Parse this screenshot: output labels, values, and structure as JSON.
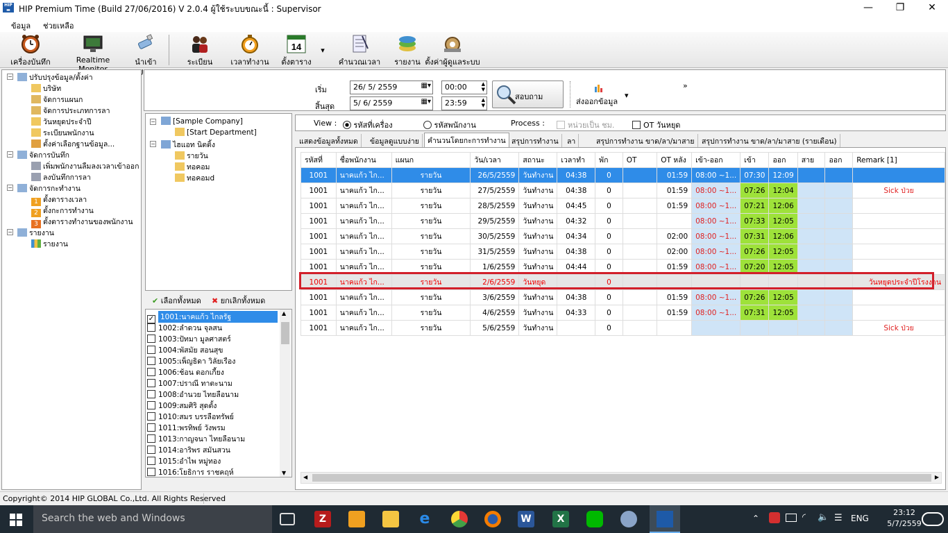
{
  "window": {
    "title": "HIP Premium Time (Build 27/06/2016) V 2.0.4   ผู้ใช้ระบบขณะนี้ : Supervisor",
    "controls": [
      "—",
      "❐",
      "✕"
    ]
  },
  "menu": [
    "ข้อมูล",
    "ช่วยเหลือ"
  ],
  "toolbar": [
    {
      "label": "เครื่องบันทึกเวลา",
      "icon": "alarm-clock-icon"
    },
    {
      "label": "Realtime Monitor",
      "icon": "monitor-icon"
    },
    {
      "label": "นำเข้า USB",
      "icon": "usb-icon"
    },
    {
      "label": "ระเบียนพนักงาน",
      "icon": "employees-icon"
    },
    {
      "label": "เวลาทำงาน",
      "icon": "stopwatch-icon"
    },
    {
      "label": "ตั้งตารางเวลา",
      "icon": "calendar-icon",
      "badge": "14"
    },
    {
      "label": "คำนวณเวลาทำงาน",
      "icon": "calculate-icon"
    },
    {
      "label": "รายงาน",
      "icon": "report-icon"
    },
    {
      "label": "ตั้งค่าผู้ดูแลระบบ",
      "icon": "admin-settings-icon"
    }
  ],
  "nav_tree": [
    {
      "label": "ปรับปรุงข้อมูล/ตั้งค่า",
      "level": 0
    },
    {
      "label": "บริษัท",
      "level": 1
    },
    {
      "label": "จัดการแผนก",
      "level": 1
    },
    {
      "label": "จัดการประเภทการลา",
      "level": 1
    },
    {
      "label": "วันหยุดประจำปี",
      "level": 1
    },
    {
      "label": "ระเบียนพนักงาน",
      "level": 1
    },
    {
      "label": "ตั้งค่าเลือกฐานข้อมูล...",
      "level": 1
    },
    {
      "label": "จัดการบันทึก",
      "level": 0
    },
    {
      "label": "เพิ่มพนักงานลืมลงเวลาเข้าออก",
      "level": 1
    },
    {
      "label": "ลงบันทึกการลา",
      "level": 1
    },
    {
      "label": "จัดการกะทำงาน",
      "level": 0
    },
    {
      "label": "ตั้งตารางเวลา",
      "level": 1,
      "num": "1"
    },
    {
      "label": "ตั้งกะการทำงาน",
      "level": 1,
      "num": "2"
    },
    {
      "label": "ตั้งตารางทำงานของพนักงาน",
      "level": 1,
      "num": "3"
    },
    {
      "label": "รายงาน",
      "level": 0
    },
    {
      "label": "รายงาน",
      "level": 1
    }
  ],
  "query": {
    "start_label": "เริ่ม",
    "end_label": "สิ้นสุด",
    "start_date": "26/  5/  2559",
    "end_date": "5/  6/  2559",
    "start_time": "00:00",
    "end_time": "23:59",
    "search_label": "สอบถาม",
    "export_label": "ส่งออกข้อมูล",
    "more": "»"
  },
  "dept_tree": [
    {
      "label": "[Sample Company]",
      "level": 0
    },
    {
      "label": "[Start Department]",
      "level": 1
    },
    {
      "label": "ไฮแอท นิตติ้ง",
      "level": 0
    },
    {
      "label": "รายวัน",
      "level": 1
    },
    {
      "label": "ทอคอม",
      "level": 1
    },
    {
      "label": "ทอคอมd",
      "level": 1
    }
  ],
  "select_bar": {
    "select_all": "เลือกทั้งหมด",
    "deselect_all": "ยกเลิกทั้งหมด"
  },
  "employees": [
    {
      "label": "1001:นาคแก้ว  ไกลรัฐ",
      "checked": true
    },
    {
      "label": "1002:ลำดวน  จุลสน",
      "checked": false
    },
    {
      "label": "1003:ปัทมา  มูลศาสตร์",
      "checked": false
    },
    {
      "label": "1004:พัสมัย  สอนสุข",
      "checked": false
    },
    {
      "label": "1005:เพ็ญธิดา  วิลัยเรือง",
      "checked": false
    },
    {
      "label": "1006:ช้อน ดอกเกี้ยง",
      "checked": false
    },
    {
      "label": "1007:ปราณี  ทาตะนาม",
      "checked": false
    },
    {
      "label": "1008:อำนวย  ไทยลือนาม",
      "checked": false
    },
    {
      "label": "1009:สมศิริ  สุดตั้ง",
      "checked": false
    },
    {
      "label": "1010:สมร  บรรลือทรัพย์",
      "checked": false
    },
    {
      "label": "1011:พรทิพย์  วังพรม",
      "checked": false
    },
    {
      "label": "1013:กาญจนา  ไทยลือนาม",
      "checked": false
    },
    {
      "label": "1014:อาริพร  สมันสวน",
      "checked": false
    },
    {
      "label": "1015:อำไพ  หมู่ทอง",
      "checked": false
    },
    {
      "label": "1016:โยธิการ ราชคฤห์",
      "checked": false
    }
  ],
  "view_bar": {
    "view_label": "View :",
    "opt1": "รหัสที่เครื่อง",
    "opt2": "รหัสพนักงาน",
    "process_label": "Process :",
    "unit_label": "หน่วยเป็น ชม.",
    "ot_holiday_label": "OT วันหยุด"
  },
  "tabs": [
    "แสดงข้อมูลทั้งหมด",
    "ข้อมูลดูแบบง่าย",
    "คำนวนโดยกะการทำงาน",
    "สรุปการทำงาน",
    "ลา",
    "สรุปการทำงาน ขาด/ลา/มาสาย",
    "สรุปการทำงาน ขาด/ลา/มาสาย (รายเดือน)"
  ],
  "active_tab": 2,
  "grid": {
    "columns": [
      "รหัสที่",
      "ชื่อพนักงาน",
      "แผนก",
      "วัน/เวลา",
      "สถานะ",
      "เวลาทำ",
      "พัก",
      "OT",
      "OT หลัง",
      "เข้า-ออก",
      "เข้า",
      "ออก",
      "สาย",
      "ออก",
      "Remark [1]"
    ],
    "rows": [
      {
        "id": "1001",
        "name": "นาคแก้ว  ไก...",
        "dept": "รายวัน",
        "date": "26/5/2559",
        "status": "วันทำงาน",
        "work": "04:38",
        "brk": "0",
        "ot": "",
        "ot_after": "01:59",
        "inout": "08:00 ~1...",
        "in": "07:30",
        "out": "12:09",
        "late": "",
        "out2": "",
        "remark": "",
        "style": "sel"
      },
      {
        "id": "1001",
        "name": "นาคแก้ว  ไก...",
        "dept": "รายวัน",
        "date": "27/5/2559",
        "status": "วันทำงาน",
        "work": "04:38",
        "brk": "0",
        "ot": "",
        "ot_after": "01:59",
        "inout": "08:00 ~1...",
        "in": "07:26",
        "out": "12:04",
        "late": "",
        "out2": "",
        "remark": "Sick ป่วย",
        "style": ""
      },
      {
        "id": "1001",
        "name": "นาคแก้ว  ไก...",
        "dept": "รายวัน",
        "date": "28/5/2559",
        "status": "วันทำงาน",
        "work": "04:45",
        "brk": "0",
        "ot": "",
        "ot_after": "01:59",
        "inout": "08:00 ~1...",
        "in": "07:21",
        "out": "12:06",
        "late": "",
        "out2": "",
        "remark": "",
        "style": ""
      },
      {
        "id": "1001",
        "name": "นาคแก้ว  ไก...",
        "dept": "รายวัน",
        "date": "29/5/2559",
        "status": "วันทำงาน",
        "work": "04:32",
        "brk": "0",
        "ot": "",
        "ot_after": "",
        "inout": "08:00 ~1...",
        "in": "07:33",
        "out": "12:05",
        "late": "",
        "out2": "",
        "remark": "",
        "style": ""
      },
      {
        "id": "1001",
        "name": "นาคแก้ว  ไก...",
        "dept": "รายวัน",
        "date": "30/5/2559",
        "status": "วันทำงาน",
        "work": "04:34",
        "brk": "0",
        "ot": "",
        "ot_after": "02:00",
        "inout": "08:00 ~1...",
        "in": "07:31",
        "out": "12:06",
        "late": "",
        "out2": "",
        "remark": "",
        "style": ""
      },
      {
        "id": "1001",
        "name": "นาคแก้ว  ไก...",
        "dept": "รายวัน",
        "date": "31/5/2559",
        "status": "วันทำงาน",
        "work": "04:38",
        "brk": "0",
        "ot": "",
        "ot_after": "02:00",
        "inout": "08:00 ~1...",
        "in": "07:26",
        "out": "12:05",
        "late": "",
        "out2": "",
        "remark": "",
        "style": ""
      },
      {
        "id": "1001",
        "name": "นาคแก้ว  ไก...",
        "dept": "รายวัน",
        "date": "1/6/2559",
        "status": "วันทำงาน",
        "work": "04:44",
        "brk": "0",
        "ot": "",
        "ot_after": "01:59",
        "inout": "08:00 ~1...",
        "in": "07:20",
        "out": "12:05",
        "late": "",
        "out2": "",
        "remark": "",
        "style": ""
      },
      {
        "id": "1001",
        "name": "นาคแก้ว  ไก...",
        "dept": "รายวัน",
        "date": "2/6/2559",
        "status": "วันหยุด",
        "work": "",
        "brk": "0",
        "ot": "",
        "ot_after": "",
        "inout": "",
        "in": "",
        "out": "",
        "late": "",
        "out2": "",
        "remark": "วันหยุดประจำปีโรงงาน",
        "style": "hol"
      },
      {
        "id": "1001",
        "name": "นาคแก้ว  ไก...",
        "dept": "รายวัน",
        "date": "3/6/2559",
        "status": "วันทำงาน",
        "work": "04:38",
        "brk": "0",
        "ot": "",
        "ot_after": "01:59",
        "inout": "08:00 ~1...",
        "in": "07:26",
        "out": "12:05",
        "late": "",
        "out2": "",
        "remark": "",
        "style": ""
      },
      {
        "id": "1001",
        "name": "นาคแก้ว  ไก...",
        "dept": "รายวัน",
        "date": "4/6/2559",
        "status": "วันทำงาน",
        "work": "04:33",
        "brk": "0",
        "ot": "",
        "ot_after": "01:59",
        "inout": "08:00 ~1...",
        "in": "07:31",
        "out": "12:05",
        "late": "",
        "out2": "",
        "remark": "",
        "style": ""
      },
      {
        "id": "1001",
        "name": "นาคแก้ว  ไก...",
        "dept": "รายวัน",
        "date": "5/6/2559",
        "status": "วันทำงาน",
        "work": "",
        "brk": "0",
        "ot": "",
        "ot_after": "",
        "inout": "",
        "in": "",
        "out": "",
        "late": "",
        "out2": "",
        "remark": "Sick ป่วย",
        "style": "blank"
      }
    ]
  },
  "status_bar": {
    "copyright": "Copyright© 2014 HIP GLOBAL Co.,Ltd. All Rights Reserved"
  },
  "taskbar": {
    "search_placeholder": "Search the web and Windows",
    "lang": "ENG",
    "time": "23:12",
    "date": "5/7/2559",
    "apps": [
      "task-view-icon",
      "filezilla-icon",
      "outlook-icon",
      "file-explorer-icon",
      "edge-icon",
      "chrome-icon",
      "firefox-icon",
      "word-icon",
      "excel-icon",
      "line-icon",
      "paint-icon",
      "hip-app-icon"
    ]
  },
  "colors": {
    "selected_row": "#2f8ce8",
    "in_out_green": "#9ee23a",
    "holiday_highlight": "#d21f2a",
    "late_red": "#e02020"
  }
}
